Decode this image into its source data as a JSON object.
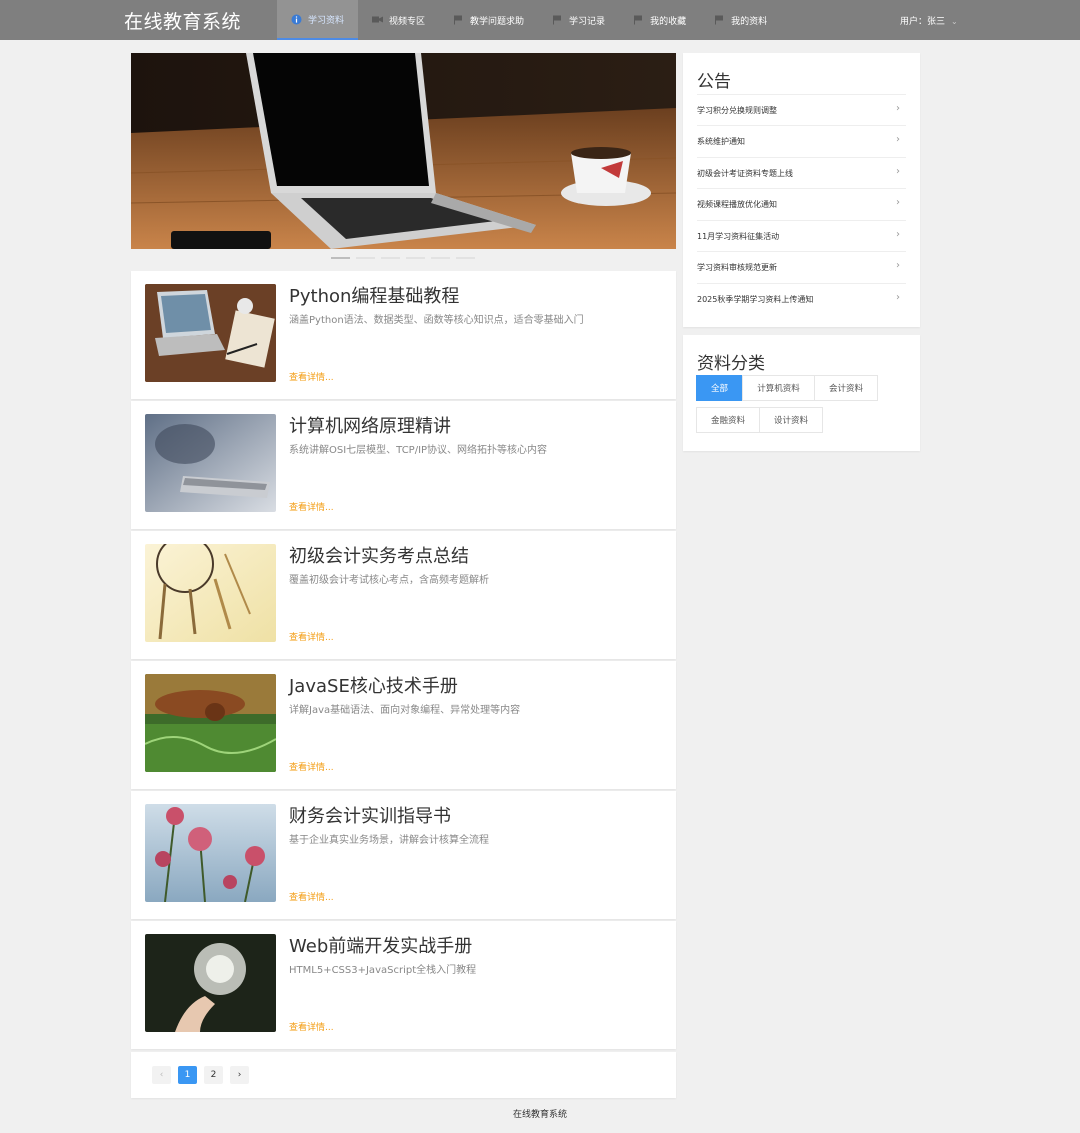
{
  "header": {
    "brand": "在线教育系统",
    "nav": [
      {
        "label": "学习资料",
        "icon": "info-icon"
      },
      {
        "label": "视频专区",
        "icon": "video-icon"
      },
      {
        "label": "教学问题求助",
        "icon": "flag-icon"
      },
      {
        "label": "学习记录",
        "icon": "flag-icon"
      },
      {
        "label": "我的收藏",
        "icon": "flag-icon"
      },
      {
        "label": "我的资料",
        "icon": "flag-icon"
      }
    ],
    "user": "用户：张三"
  },
  "banner": {
    "slides": 6,
    "active": 1
  },
  "materials": [
    {
      "title": "Python编程基础教程",
      "desc": "涵盖Python语法、数据类型、函数等核心知识点，适合零基础入门",
      "link": "查看详情..."
    },
    {
      "title": "计算机网络原理精讲",
      "desc": "系统讲解OSI七层模型、TCP/IP协议、网络拓扑等核心内容",
      "link": "查看详情..."
    },
    {
      "title": "初级会计实务考点总结",
      "desc": "覆盖初级会计考试核心考点，含高频考题解析",
      "link": "查看详情..."
    },
    {
      "title": "JavaSE核心技术手册",
      "desc": "详解Java基础语法、面向对象编程、异常处理等内容",
      "link": "查看详情..."
    },
    {
      "title": "财务会计实训指导书",
      "desc": "基于企业真实业务场景，讲解会计核算全流程",
      "link": "查看详情..."
    },
    {
      "title": "Web前端开发实战手册",
      "desc": "HTML5+CSS3+JavaScript全栈入门教程",
      "link": "查看详情..."
    }
  ],
  "pagination": {
    "prev": "‹",
    "pages": [
      "1",
      "2"
    ],
    "current": "1",
    "next": "›"
  },
  "notices": {
    "title": "公告",
    "items": [
      "学习积分兑换规则调整",
      "系统维护通知",
      "初级会计考证资料专题上线",
      "视频课程播放优化通知",
      "11月学习资料征集活动",
      "学习资料审核规范更新",
      "2025秋季学期学习资料上传通知"
    ]
  },
  "categories": {
    "title": "资料分类",
    "items": [
      "全部",
      "计算机资料",
      "会计资料",
      "金融资料",
      "设计资料"
    ],
    "active": "全部"
  },
  "footer": "在线教育系统",
  "colors": {
    "header_bg": "#7f7f7f",
    "accent": "#3a97f3",
    "link": "#f39c12"
  }
}
